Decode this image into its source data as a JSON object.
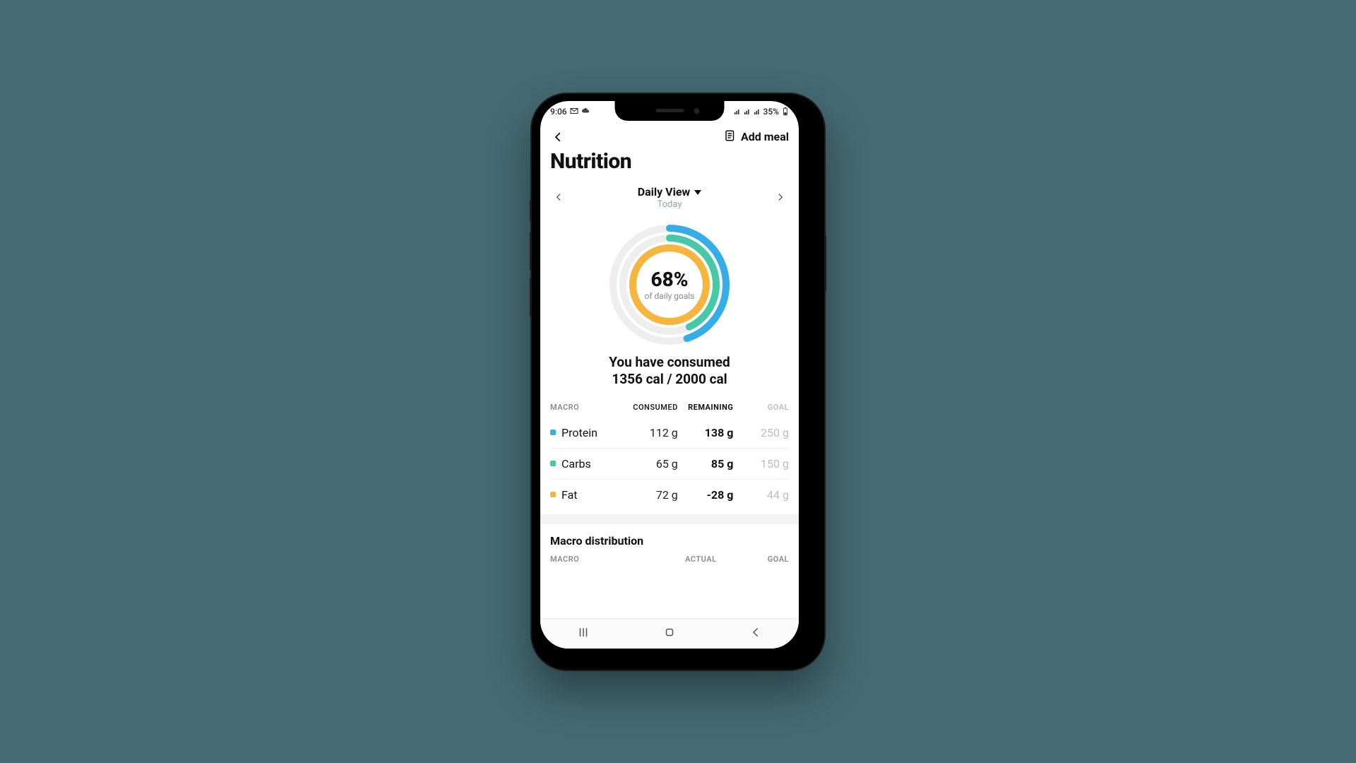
{
  "status": {
    "time": "9:06",
    "battery_text": "35%"
  },
  "header": {
    "add_meal_label": "Add meal",
    "page_title": "Nutrition"
  },
  "date_nav": {
    "view_label": "Daily View",
    "date_label": "Today"
  },
  "summary": {
    "percent_label": "68%",
    "percent_sub": "of daily goals",
    "consumed_line1": "You have consumed",
    "consumed_line2": "1356 cal / 2000 cal"
  },
  "macro_headers": {
    "c1": "Macro",
    "c2": "Consumed",
    "c3": "Remaining",
    "c4": "Goal"
  },
  "macros": [
    {
      "name": "Protein",
      "consumed": "112 g",
      "remaining": "138 g",
      "goal": "250 g",
      "color": "#35aee6"
    },
    {
      "name": "Carbs",
      "consumed": "65 g",
      "remaining": "85 g",
      "goal": "150 g",
      "color": "#46c9a6"
    },
    {
      "name": "Fat",
      "consumed": "72 g",
      "remaining": "-28 g",
      "goal": "44 g",
      "color": "#f5b53f"
    }
  ],
  "distribution": {
    "title": "Macro distribution",
    "h1": "Macro",
    "h2": "Actual",
    "h3": "Goal"
  },
  "colors": {
    "protein": "#35aee6",
    "carbs": "#46c9a6",
    "fat": "#f5b53f",
    "track": "#eeeeee"
  },
  "chart_data": {
    "type": "pie",
    "title": "Daily nutrition goal progress",
    "center_label": "68% of daily goals",
    "series": [
      {
        "name": "Fat (inner ring)",
        "color": "#f5b53f",
        "value_fraction": 1.0,
        "goal": 44,
        "consumed": 72,
        "unit": "g",
        "note": "over goal, ring drawn full"
      },
      {
        "name": "Carbs (middle ring)",
        "color": "#46c9a6",
        "value_fraction": 0.43,
        "goal": 150,
        "consumed": 65,
        "unit": "g"
      },
      {
        "name": "Protein (outer ring)",
        "color": "#35aee6",
        "value_fraction": 0.45,
        "goal": 250,
        "consumed": 112,
        "unit": "g"
      }
    ],
    "calories": {
      "consumed": 1356,
      "goal": 2000,
      "fraction": 0.68
    }
  }
}
